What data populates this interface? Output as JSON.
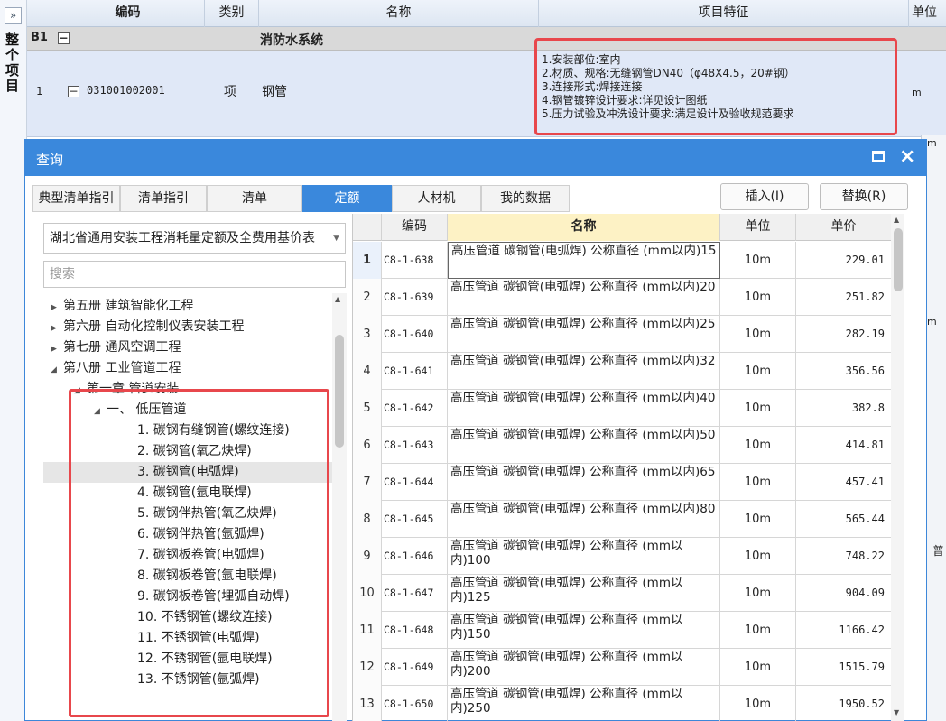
{
  "background": {
    "expand_icon": "»",
    "whole_project_label": "整个项目",
    "headers": {
      "code": "编码",
      "category": "类别",
      "name": "名称",
      "features": "项目特征",
      "unit": "单位"
    },
    "section_row": {
      "id": "B1",
      "toggle": "−",
      "name": "消防水系统"
    },
    "item_row": {
      "no": "1",
      "toggle": "−",
      "code": "031001002001",
      "category": "项",
      "name": "钢管",
      "features": [
        "1.安装部位:室内",
        "2.材质、规格:无缝钢管DN40（φ48X4.5，20#钢）",
        "3.连接形式:焊接连接",
        "4.钢管镀锌设计要求:详见设计图纸",
        "5.压力试验及冲洗设计要求:满足设计及验收规范要求"
      ],
      "unit": "m"
    },
    "right_edge": {
      "unit_m_1": "m",
      "unit_m_2": "m",
      "fragment": "普"
    }
  },
  "dialog": {
    "title": "查询",
    "close_icon": "×",
    "tabs": [
      "典型清单指引",
      "清单指引",
      "清单",
      "定额",
      "人材机",
      "我的数据"
    ],
    "active_tab": "定额",
    "insert_label": "插入(I)",
    "replace_label": "替换(R)",
    "library_value": "湖北省通用安装工程消耗量定额及全费用基价表",
    "search_placeholder": "搜索",
    "tree": [
      {
        "label": "第五册 建筑智能化工程",
        "arrow": "▶"
      },
      {
        "label": "第六册 自动化控制仪表安装工程",
        "arrow": "▶"
      },
      {
        "label": "第七册 通风空调工程",
        "arrow": "▶"
      },
      {
        "label": "第八册 工业管道工程",
        "arrow": "◢"
      },
      {
        "label": "第一章 管道安装",
        "arrow": "◢"
      },
      {
        "label": "一、 低压管道",
        "arrow": "◢"
      },
      {
        "label": "1. 碳钢有缝钢管(螺纹连接)"
      },
      {
        "label": "2. 碳钢管(氧乙炔焊)"
      },
      {
        "label": "3. 碳钢管(电弧焊)"
      },
      {
        "label": "4. 碳钢管(氩电联焊)"
      },
      {
        "label": "5. 碳钢伴热管(氧乙炔焊)"
      },
      {
        "label": "6. 碳钢伴热管(氩弧焊)"
      },
      {
        "label": "7. 碳钢板卷管(电弧焊)"
      },
      {
        "label": "8. 碳钢板卷管(氩电联焊)"
      },
      {
        "label": "9. 碳钢板卷管(埋弧自动焊)"
      },
      {
        "label": "10. 不锈钢管(螺纹连接)"
      },
      {
        "label": "11. 不锈钢管(电弧焊)"
      },
      {
        "label": "12. 不锈钢管(氩电联焊)"
      },
      {
        "label": "13. 不锈钢管(氩弧焊)"
      }
    ],
    "selected_tree_index": 8,
    "table": {
      "headers": {
        "code": "编码",
        "name": "名称",
        "unit": "单位",
        "price": "单价"
      },
      "rows": [
        {
          "no": "1",
          "code": "C8-1-638",
          "name": "高压管道 碳钢管(电弧焊) 公称直径 (mm以内)15",
          "unit": "10m",
          "price": "229.01"
        },
        {
          "no": "2",
          "code": "C8-1-639",
          "name": "高压管道 碳钢管(电弧焊) 公称直径 (mm以内)20",
          "unit": "10m",
          "price": "251.82"
        },
        {
          "no": "3",
          "code": "C8-1-640",
          "name": "高压管道 碳钢管(电弧焊) 公称直径 (mm以内)25",
          "unit": "10m",
          "price": "282.19"
        },
        {
          "no": "4",
          "code": "C8-1-641",
          "name": "高压管道 碳钢管(电弧焊) 公称直径 (mm以内)32",
          "unit": "10m",
          "price": "356.56"
        },
        {
          "no": "5",
          "code": "C8-1-642",
          "name": "高压管道 碳钢管(电弧焊) 公称直径 (mm以内)40",
          "unit": "10m",
          "price": "382.8"
        },
        {
          "no": "6",
          "code": "C8-1-643",
          "name": "高压管道 碳钢管(电弧焊) 公称直径 (mm以内)50",
          "unit": "10m",
          "price": "414.81"
        },
        {
          "no": "7",
          "code": "C8-1-644",
          "name": "高压管道 碳钢管(电弧焊) 公称直径 (mm以内)65",
          "unit": "10m",
          "price": "457.41"
        },
        {
          "no": "8",
          "code": "C8-1-645",
          "name": "高压管道 碳钢管(电弧焊) 公称直径 (mm以内)80",
          "unit": "10m",
          "price": "565.44"
        },
        {
          "no": "9",
          "code": "C8-1-646",
          "name": "高压管道 碳钢管(电弧焊) 公称直径 (mm以内)100",
          "unit": "10m",
          "price": "748.22"
        },
        {
          "no": "10",
          "code": "C8-1-647",
          "name": "高压管道 碳钢管(电弧焊) 公称直径 (mm以内)125",
          "unit": "10m",
          "price": "904.09"
        },
        {
          "no": "11",
          "code": "C8-1-648",
          "name": "高压管道 碳钢管(电弧焊) 公称直径 (mm以内)150",
          "unit": "10m",
          "price": "1166.42"
        },
        {
          "no": "12",
          "code": "C8-1-649",
          "name": "高压管道 碳钢管(电弧焊) 公称直径 (mm以内)200",
          "unit": "10m",
          "price": "1515.79"
        },
        {
          "no": "13",
          "code": "C8-1-650",
          "name": "高压管道 碳钢管(电弧焊) 公称直径 (mm以内)250",
          "unit": "10m",
          "price": "1950.52"
        }
      ],
      "selected_row": 0
    }
  },
  "colors": {
    "accent": "#3a88dc",
    "highlight_box": "#e8474c",
    "header_highlight": "#fdf2c5"
  }
}
